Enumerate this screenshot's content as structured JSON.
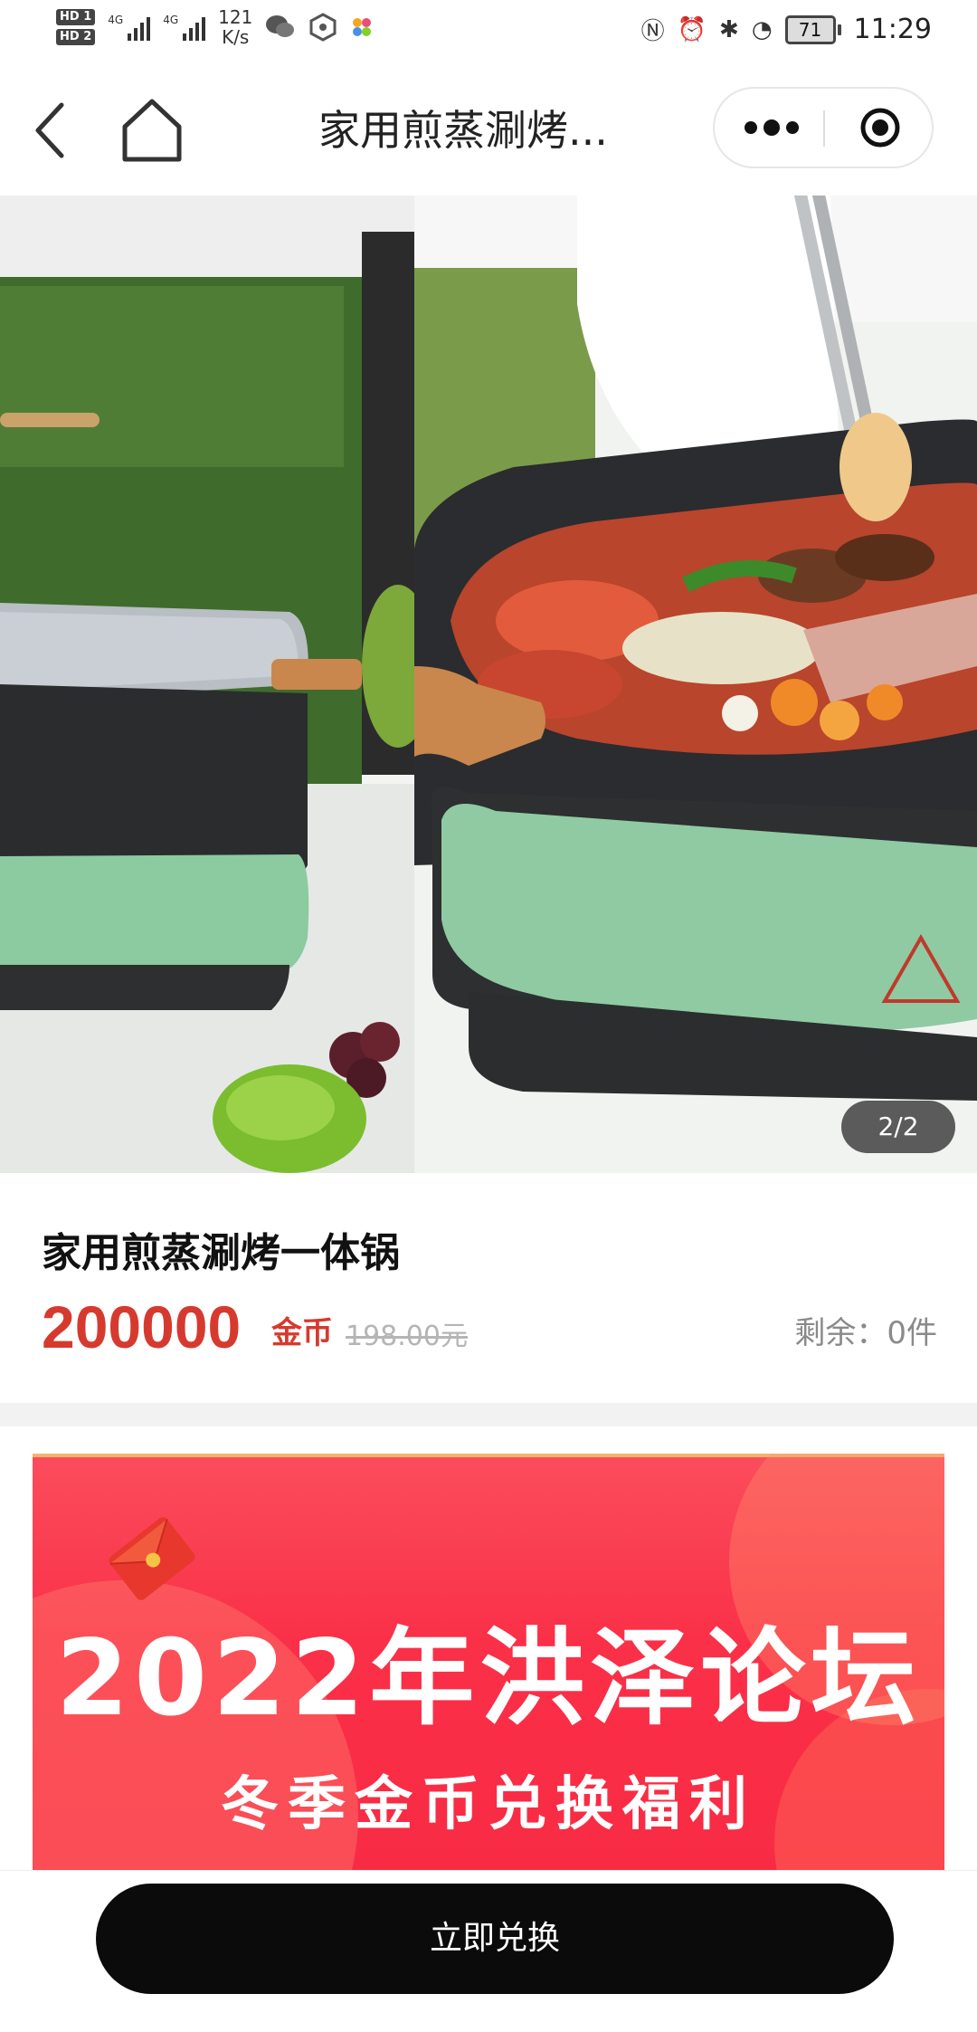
{
  "status_bar": {
    "hd1": "HD 1",
    "hd2": "HD 2",
    "network1": "4G",
    "network2": "4G",
    "speed_value": "121",
    "speed_unit": "K/s",
    "battery": "71",
    "time": "11:29"
  },
  "nav": {
    "title": "家用煎蒸涮烤...",
    "back_icon": "back-arrow-icon",
    "home_icon": "home-icon",
    "more_icon": "more-dots-icon",
    "close_icon": "target-circle-icon"
  },
  "gallery": {
    "indicator": "2/2"
  },
  "product": {
    "name": "家用煎蒸涮烤一体锅",
    "price_value": "200000",
    "price_unit": "金币",
    "original_price": "198.00元",
    "stock": "剩余：0件"
  },
  "banner": {
    "title": "2022年洪泽论坛",
    "subtitle": "冬季金币兑换福利"
  },
  "actions": {
    "redeem_label": "立即兑换"
  },
  "colors": {
    "price_red": "#d63a2e",
    "banner_red": "#fa3048",
    "button_black": "#0b0b0b"
  }
}
